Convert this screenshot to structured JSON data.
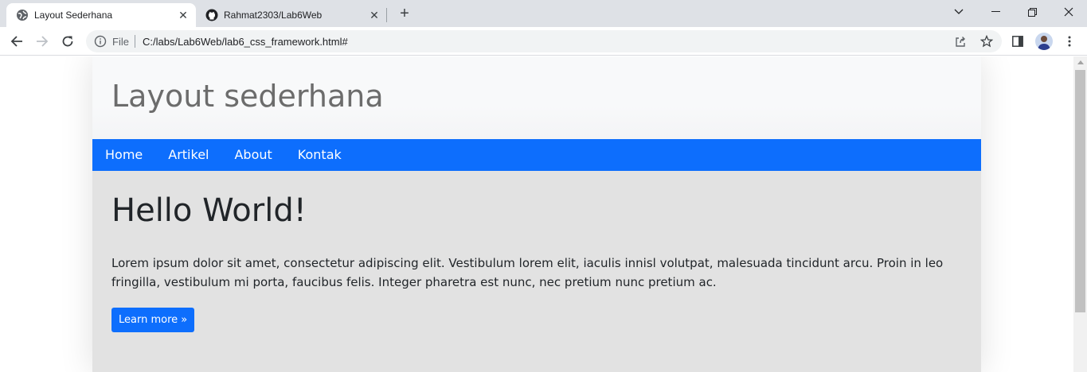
{
  "browser": {
    "tabs": [
      {
        "title": "Layout Sederhana",
        "active": true,
        "icon": "globe-icon"
      },
      {
        "title": "Rahmat2303/Lab6Web",
        "active": false,
        "icon": "github-icon"
      }
    ],
    "address": {
      "scheme_label": "File",
      "url": "C:/labs/Lab6Web/lab6_css_framework.html#"
    }
  },
  "page": {
    "header_title": "Layout sederhana",
    "nav": [
      "Home",
      "Artikel",
      "About",
      "Kontak"
    ],
    "hero": {
      "heading": "Hello World!",
      "text": "Lorem ipsum dolor sit amet, consectetur adipiscing elit. Vestibulum lorem elit, iaculis innisl volutpat, malesuada tincidunt arcu. Proin in leo fringilla, vestibulum mi porta, faucibus felis. Integer pharetra est nunc, nec pretium nunc pretium ac.",
      "button": "Learn more »"
    }
  },
  "colors": {
    "primary": "#0d6efd",
    "hero_bg": "#e2e2e2",
    "header_bg": "#f8f9fa",
    "tabstrip_bg": "#dee1e6"
  }
}
